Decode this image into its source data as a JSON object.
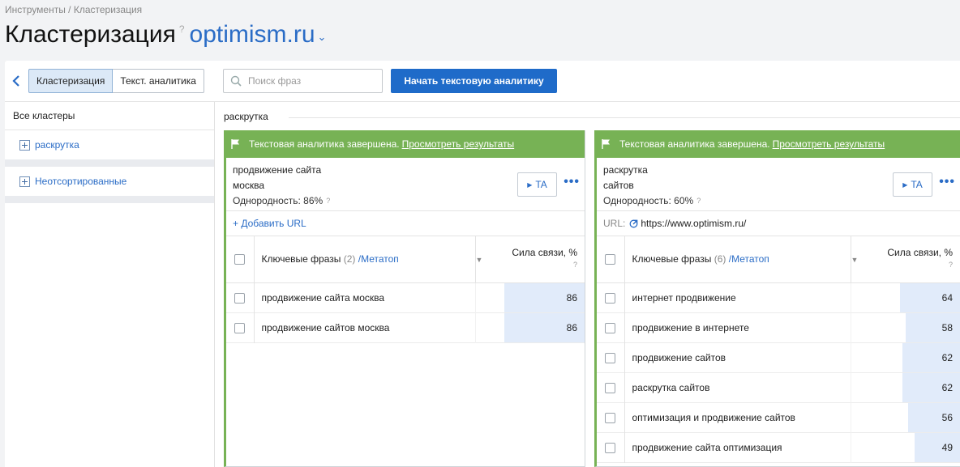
{
  "breadcrumb": "Инструменты / Кластеризация",
  "page": {
    "title": "Кластеризация",
    "help": "?",
    "domain": "optimism.ru"
  },
  "toolbar": {
    "tabs": [
      "Кластеризация",
      "Текст. аналитика"
    ],
    "search_placeholder": "Поиск фраз",
    "start_button": "Начать текстовую аналитику"
  },
  "sidebar": {
    "all_label": "Все кластеры",
    "groups": [
      "раскрутка",
      "Неотсортированные"
    ]
  },
  "content": {
    "group_title": "раскрутка"
  },
  "cards": [
    {
      "banner_text": "Текстовая аналитика завершена.",
      "banner_link": "Просмотреть результаты",
      "line1": "продвижение сайта",
      "line2": "москва",
      "homogeneity": "Однородность: 86%",
      "help": "?",
      "ta_label": "TA",
      "url_action": "+ Добавить URL",
      "url_label": "",
      "url_value": "",
      "table": {
        "phrases_header": "Ключевые фразы",
        "count": "(2)",
        "meta_link": "/Метатоп",
        "strength_header": "Сила связи, %",
        "strength_help": "?",
        "rows": [
          {
            "phrase": "продвижение сайта москва",
            "value": "86"
          },
          {
            "phrase": "продвижение сайтов москва",
            "value": "86"
          }
        ]
      }
    },
    {
      "banner_text": "Текстовая аналитика завершена.",
      "banner_link": "Просмотреть результаты",
      "line1": "раскрутка",
      "line2": "сайтов",
      "homogeneity": "Однородность: 60%",
      "help": "?",
      "ta_label": "TA",
      "url_action": "",
      "url_label": "URL:",
      "url_value": "https://www.optimism.ru/",
      "table": {
        "phrases_header": "Ключевые фразы",
        "count": "(6)",
        "meta_link": "/Метатоп",
        "strength_header": "Сила связи, %",
        "strength_help": "?",
        "rows": [
          {
            "phrase": "интернет продвижение",
            "value": "64"
          },
          {
            "phrase": "продвижение в интернете",
            "value": "58"
          },
          {
            "phrase": "продвижение сайтов",
            "value": "62"
          },
          {
            "phrase": "раскрутка сайтов",
            "value": "62"
          },
          {
            "phrase": "оптимизация и продвижение сайтов",
            "value": "56"
          },
          {
            "phrase": "продвижение сайта оптимизация",
            "value": "49"
          }
        ]
      }
    }
  ],
  "colors": {
    "accent": "#1f6bc9",
    "link": "#2a6cc6",
    "success": "#77b255",
    "bar_fill": "#e1ebfa"
  }
}
